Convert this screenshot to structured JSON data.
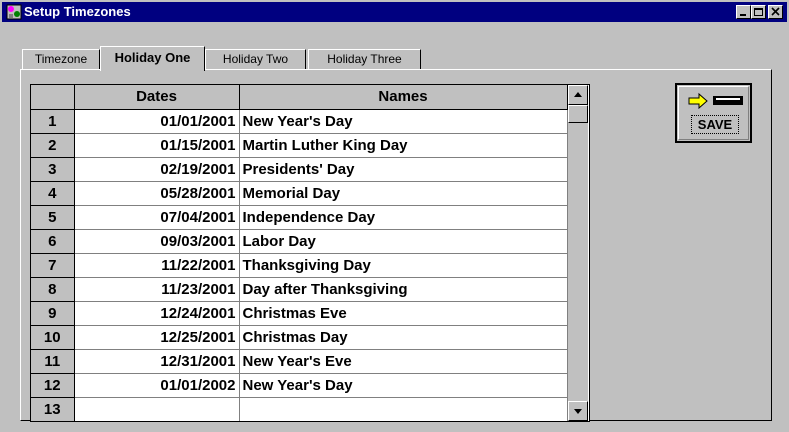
{
  "window": {
    "title": "Setup Timezones",
    "controls": [
      "minimize-icon",
      "maximize-icon",
      "close-icon"
    ]
  },
  "tabs": [
    {
      "label": "Timezone",
      "active": false
    },
    {
      "label": "Holiday One",
      "active": true
    },
    {
      "label": "Holiday Two",
      "active": false
    },
    {
      "label": "Holiday Three",
      "active": false
    }
  ],
  "grid": {
    "columns": [
      "",
      "Dates",
      "Names"
    ],
    "rows": [
      {
        "num": "1",
        "date": "01/01/2001",
        "name": "New Year's Day"
      },
      {
        "num": "2",
        "date": "01/15/2001",
        "name": "Martin Luther King Day"
      },
      {
        "num": "3",
        "date": "02/19/2001",
        "name": "Presidents' Day"
      },
      {
        "num": "4",
        "date": "05/28/2001",
        "name": "Memorial Day"
      },
      {
        "num": "5",
        "date": "07/04/2001",
        "name": "Independence Day"
      },
      {
        "num": "6",
        "date": "09/03/2001",
        "name": "Labor Day"
      },
      {
        "num": "7",
        "date": "11/22/2001",
        "name": "Thanksgiving Day"
      },
      {
        "num": "8",
        "date": "11/23/2001",
        "name": "Day after Thanksgiving"
      },
      {
        "num": "9",
        "date": "12/24/2001",
        "name": "Christmas Eve"
      },
      {
        "num": "10",
        "date": "12/25/2001",
        "name": "Christmas Day"
      },
      {
        "num": "11",
        "date": "12/31/2001",
        "name": "New Year's Eve"
      },
      {
        "num": "12",
        "date": "01/01/2002",
        "name": "New Year's Day"
      },
      {
        "num": "13",
        "date": "",
        "name": ""
      }
    ]
  },
  "save_button": {
    "label": "SAVE",
    "icon": "save-arrow-icon"
  },
  "colors": {
    "titlebar": "#000080",
    "face": "#c0c0c0",
    "arrow": "#ffff00"
  }
}
